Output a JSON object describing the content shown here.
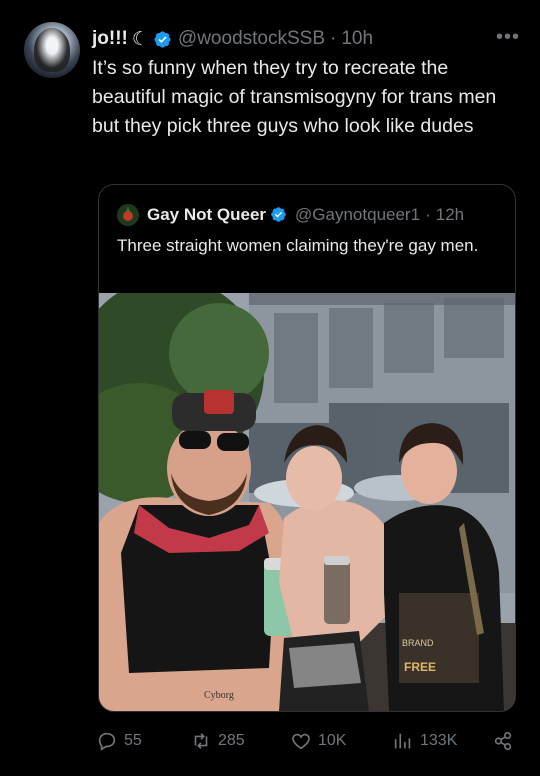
{
  "tweet": {
    "author_name": "jo!!!",
    "author_symbol": "☾",
    "handle": "@woodstockSSB",
    "separator": "·",
    "time": "10h",
    "more": "•••",
    "text": "It’s so funny when they try to recreate the beautiful magic of transmisogyny for trans men but they pick three guys who look like dudes"
  },
  "quote": {
    "author_name": "Gay Not Queer",
    "handle": "@Gaynotqueer1",
    "separator": "·",
    "time": "12h",
    "text": "Three straight women claiming they're gay men.",
    "photo_texts": {
      "tattoo": "Cyborg",
      "shirt_word_1": "BRAND",
      "shirt_word_2": "FREE"
    }
  },
  "actions": {
    "replies": "55",
    "reposts": "285",
    "likes": "10K",
    "views": "133K"
  },
  "colors": {
    "background": "#000000",
    "text_primary": "#e7e9ea",
    "text_secondary": "#71767b",
    "verified": "#1d9bf0",
    "border": "#2f3336"
  }
}
